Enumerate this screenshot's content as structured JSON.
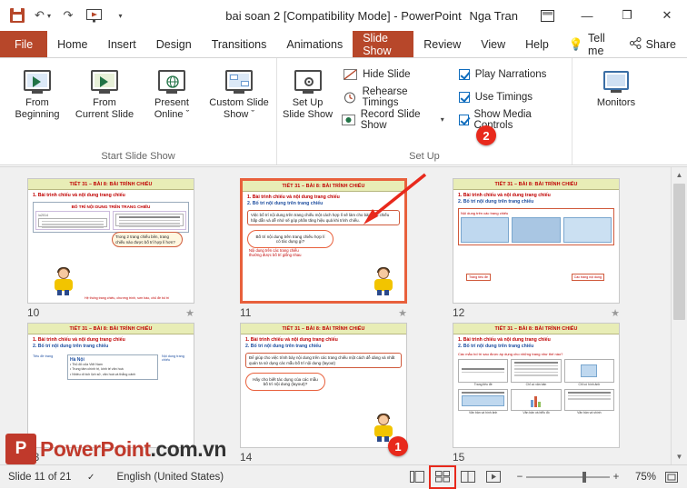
{
  "titlebar": {
    "document_title": "bai soan 2 [Compatibility Mode]",
    "app_name": "PowerPoint",
    "separator": "-",
    "user_name": "Nga Tran",
    "qat": [
      {
        "name": "save",
        "label": "Save"
      },
      {
        "name": "undo",
        "label": "↶"
      },
      {
        "name": "redo",
        "label": "↷"
      },
      {
        "name": "start-from-beginning",
        "label": "▷"
      },
      {
        "name": "customize-qat",
        "label": "▾"
      }
    ],
    "window_buttons": [
      {
        "name": "ribbon-display-options",
        "label": "⬚"
      },
      {
        "name": "minimize",
        "label": "—"
      },
      {
        "name": "restore",
        "label": "❐"
      },
      {
        "name": "close",
        "label": "✕"
      }
    ]
  },
  "ribbon_tabs": [
    {
      "label": "File",
      "active": false
    },
    {
      "label": "Home",
      "active": false
    },
    {
      "label": "Insert",
      "active": false
    },
    {
      "label": "Design",
      "active": false
    },
    {
      "label": "Transitions",
      "active": false
    },
    {
      "label": "Animations",
      "active": false
    },
    {
      "label": "Slide Show",
      "active": true
    },
    {
      "label": "Review",
      "active": false
    },
    {
      "label": "View",
      "active": false
    },
    {
      "label": "Help",
      "active": false
    }
  ],
  "tell_me": "Tell me",
  "share": "Share",
  "ribbon": {
    "groups": [
      {
        "label": "Start Slide Show",
        "buttons": [
          {
            "label": "From\nBeginning",
            "name": "from-beginning"
          },
          {
            "label": "From\nCurrent Slide",
            "name": "from-current-slide"
          },
          {
            "label": "Present\nOnline ˇ",
            "name": "present-online"
          },
          {
            "label": "Custom Slide\nShow ˇ",
            "name": "custom-slide-show"
          }
        ]
      },
      {
        "label": "Set Up",
        "big_button": {
          "label": "Set Up\nSlide Show",
          "name": "set-up-slide-show"
        },
        "small_buttons": [
          {
            "label": "Hide Slide",
            "name": "hide-slide"
          },
          {
            "label": "Rehearse Timings",
            "name": "rehearse-timings"
          },
          {
            "label": "Record Slide Show",
            "name": "record-slide-show",
            "has_caret": true
          }
        ],
        "checkboxes": [
          {
            "label": "Play Narrations",
            "checked": true,
            "name": "play-narrations"
          },
          {
            "label": "Use Timings",
            "checked": true,
            "name": "use-timings"
          },
          {
            "label": "Show Media Controls",
            "checked": true,
            "name": "show-media-controls"
          }
        ]
      },
      {
        "label": "",
        "buttons": [
          {
            "label": "Monitors",
            "name": "monitors"
          }
        ]
      }
    ]
  },
  "slides": [
    {
      "number": "10",
      "selected": false,
      "header": "TIẾT 31 – BÀI 8: BÀI TRÌNH CHIẾU",
      "line1": "1. Bài trình chiếu và nội dung trang chiếu",
      "box_title": "BỐ TRÍ NỘI DUNG TRÊN TRANG CHIẾU",
      "body": "Trong 2 trang chiếu bên, trang chiếu nào được bố trí hợp lí hơn?",
      "footer": "Hệ thống trang chiếu, chương trình, sơn bào, chủ đề bố trí"
    },
    {
      "number": "11",
      "selected": true,
      "header": "TIẾT 31 – BÀI 8: BÀI TRÌNH CHIẾU",
      "line1": "1. Bài trình chiếu và nội dung trang chiếu",
      "line2": "2. Bố trí nội dung trên trang chiếu",
      "box": "Việc bố trí nội dung trên trang chiếu một cách hợp lí sẽ làm cho bài trình chiếu hấp dẫn và dễ nhớ sẽ góp phần tăng hiệu quả khi trình chiếu.",
      "cloud": "Bố trí nội dung trên trang chiếu hợp lí có tác dụng gì?",
      "note": "Nội dung trên các trang chiếu thường được bố trí giống nhau"
    },
    {
      "number": "12",
      "selected": false,
      "header": "TIẾT 31 – BÀI 8: BÀI TRÌNH CHIẾU",
      "line1": "1. Bài trình chiếu và nội dung trang chiếu",
      "line2": "2. Bố trí nội dung trên trang chiếu",
      "box_title": "Nội dung trên các trang chiếu",
      "label_left": "Trang tiêu đề",
      "label_right": "Các trang nội dung"
    },
    {
      "number": "13",
      "selected": false,
      "header": "TIẾT 31 – BÀI 8: BÀI TRÌNH CHIẾU",
      "line1": "1. Bài trình chiếu và nội dung trang chiếu",
      "line2": "2. Bố trí nội dung trên trang chiếu",
      "left_label": "Tiêu đề trang",
      "title_sample": "Hà Nội",
      "bullets": "• Thủ đô của Việt Nam\n• Trung tâm chính trị, kinh tế văn hoá\n• Nhiều di tích lịch sử, văn hoá và thắng cảnh",
      "right_label": "Nội dung trang chiếu"
    },
    {
      "number": "14",
      "selected": false,
      "header": "TIẾT 31 – BÀI 8: BÀI TRÌNH CHIẾU",
      "line1": "1. Bài trình chiếu và nội dung trang chiếu",
      "line2": "2. Bố trí nội dung trên trang chiếu",
      "box": "Để giúp cho việc trình bày nội dung trên các trang chiếu một cách dễ dàng và nhất quán ta sử dụng các mẫu bố trí nội dung (layout)",
      "cloud": "Hãy cho biết tác dụng của các mẫu bố trí nội dung (layout)?"
    },
    {
      "number": "15",
      "selected": false,
      "header": "TIẾT 31 – BÀI 8: BÀI TRÌNH CHIẾU",
      "line1": "1. Bài trình chiếu và nội dung trang chiếu",
      "line2": "2. Bố trí nội dung trên trang chiếu",
      "question": "Các mẫu bố trí sau được áp dụng cho những trang như thế nào?",
      "captions": [
        "Trang tiêu đề",
        "Chỉ có văn bản",
        "Chỉ có hình ảnh",
        "Văn bản và hình ảnh",
        "Văn bản và biểu đồ",
        "Văn bản và shình"
      ]
    }
  ],
  "annotations": [
    {
      "name": "callout-badge-1",
      "label": "1"
    },
    {
      "name": "callout-badge-2",
      "label": "2"
    }
  ],
  "watermark": {
    "logo_letter": "P",
    "brand": "PowerPoint",
    "domain": ".com.vn"
  },
  "statusbar": {
    "slide_indicator": "Slide 11 of 21",
    "language": "English (United States)",
    "zoom_level": "75%",
    "views": [
      {
        "name": "normal-view",
        "label": "normal"
      },
      {
        "name": "slide-sorter-view",
        "label": "slide sorter",
        "current": true
      },
      {
        "name": "reading-view",
        "label": "reading"
      },
      {
        "name": "slide-show-view",
        "label": "slide show"
      }
    ],
    "zoom_out": "−",
    "zoom_in": "+",
    "fit_label": "fit-to-window"
  }
}
